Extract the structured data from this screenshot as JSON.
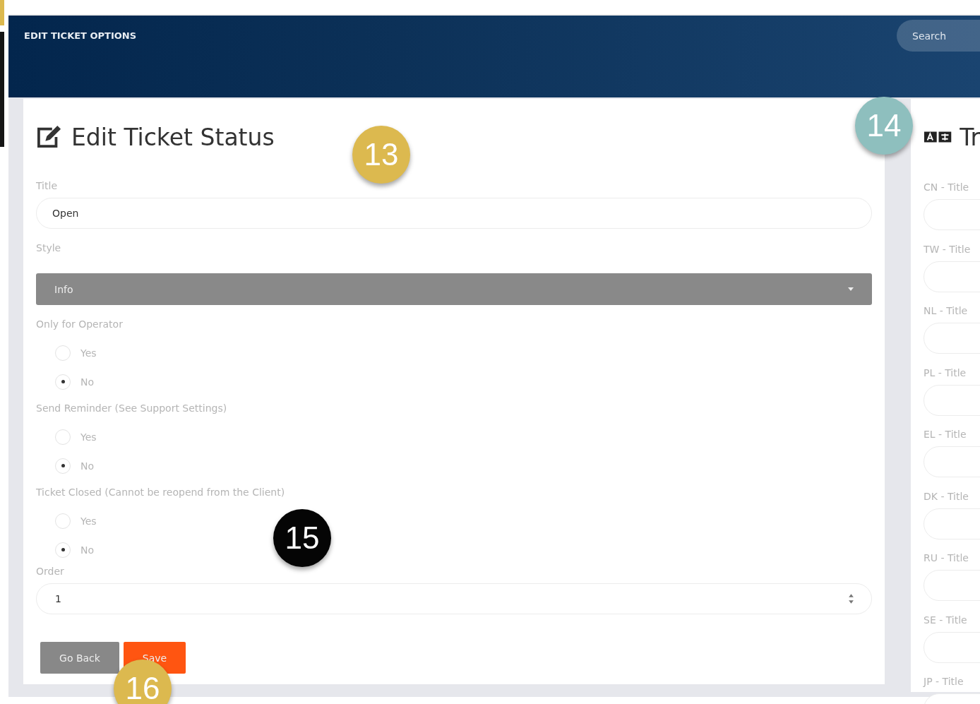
{
  "header": {
    "title": "EDIT TICKET OPTIONS",
    "search": {
      "placeholder": "Search"
    }
  },
  "form": {
    "title": "Edit Ticket Status",
    "fields": [
      {
        "kind": "text",
        "label": "Title",
        "value": "Open"
      },
      {
        "kind": "select",
        "label": "Style",
        "value": "Info"
      },
      {
        "kind": "radio",
        "label": "Only for Operator",
        "options": [
          {
            "label": "Yes",
            "selected": false
          },
          {
            "label": "No",
            "selected": true
          }
        ]
      },
      {
        "kind": "radio",
        "label": "Send Reminder (See Support Settings)",
        "options": [
          {
            "label": "Yes",
            "selected": false
          },
          {
            "label": "No",
            "selected": true
          }
        ]
      },
      {
        "kind": "radio",
        "label": "Ticket Closed (Cannot be reopend from the Client)",
        "options": [
          {
            "label": "Yes",
            "selected": false
          },
          {
            "label": "No",
            "selected": true
          }
        ]
      },
      {
        "kind": "number",
        "label": "Order",
        "value": "1"
      }
    ],
    "buttons": [
      {
        "label": "Go Back",
        "kind": "secondary"
      },
      {
        "label": "Save",
        "kind": "primary"
      }
    ]
  },
  "translations": {
    "title": "Tr",
    "fields": [
      {
        "label": "CN - Title"
      },
      {
        "label": "TW - Title"
      },
      {
        "label": "NL - Title"
      },
      {
        "label": "PL - Title"
      },
      {
        "label": "EL - Title"
      },
      {
        "label": "DK - Title"
      },
      {
        "label": "RU - Title"
      },
      {
        "label": "SE - Title"
      },
      {
        "label": "JP - Title"
      }
    ]
  },
  "callouts": [
    {
      "number": "13",
      "color": "#dcb94f"
    },
    {
      "number": "14",
      "color": "#8ebfbe"
    },
    {
      "number": "15",
      "color": "#050505"
    },
    {
      "number": "16",
      "color": "#dcb94f"
    }
  ]
}
